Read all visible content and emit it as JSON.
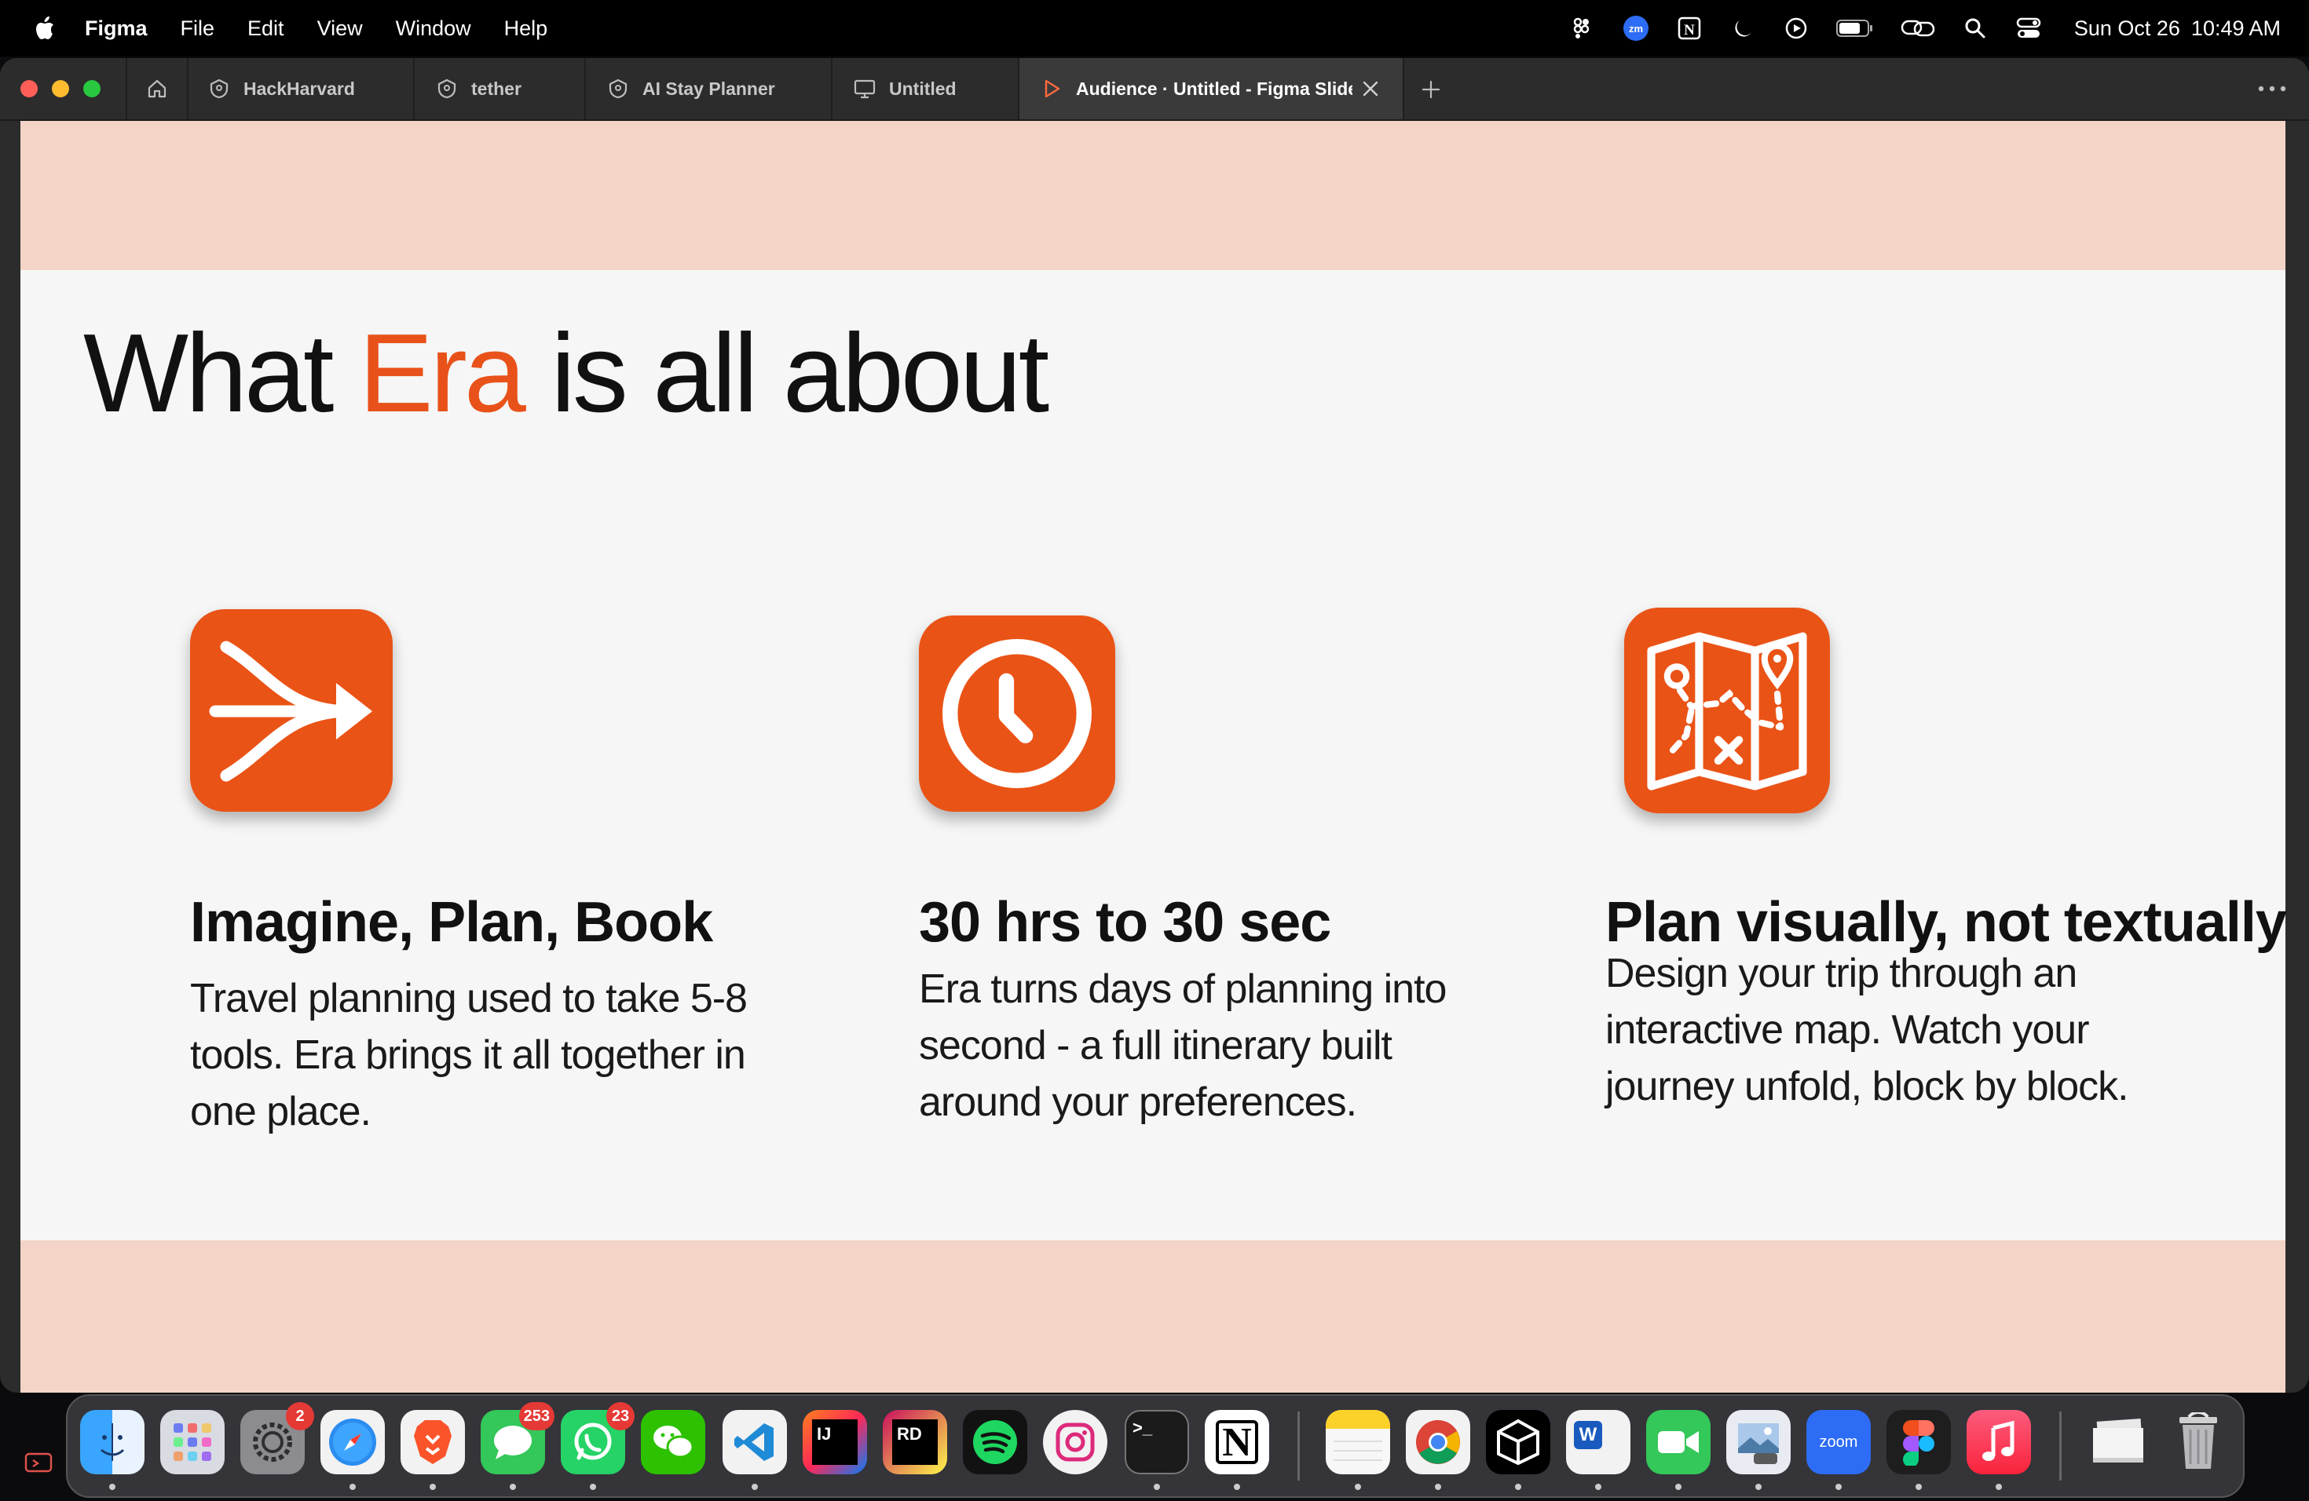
{
  "menubar": {
    "app_name": "Figma",
    "menus": [
      "File",
      "Edit",
      "View",
      "Window",
      "Help"
    ],
    "status_icons": [
      "figma-mirror-icon",
      "zoom-icon",
      "notion-icon",
      "moon-icon",
      "play-icon",
      "battery-icon",
      "link-icon",
      "search-icon",
      "control-center-icon"
    ],
    "date": "Sun Oct 26",
    "time": "10:49 AM"
  },
  "tabs": [
    {
      "label": "HackHarvard",
      "icon": "figma-file-icon"
    },
    {
      "label": "tether",
      "icon": "figma-file-icon"
    },
    {
      "label": "AI Stay Planner",
      "icon": "figma-file-icon"
    },
    {
      "label": "Untitled",
      "icon": "slides-icon"
    },
    {
      "label": "Audience · Untitled - Figma Slide",
      "icon": "play-icon",
      "active": true
    }
  ],
  "slide": {
    "title_before": "What ",
    "title_accent": "Era",
    "title_after": " is all about",
    "features": [
      {
        "icon": "merge-arrow-icon",
        "heading": "Imagine, Plan, Book",
        "lines": [
          "Travel planning used to take 5-8",
          "tools. Era brings it all together in",
          "one place."
        ]
      },
      {
        "icon": "clock-icon",
        "heading": "30 hrs to 30 sec",
        "lines": [
          "Era turns days of planning into",
          "second - a full itinerary built",
          "around your preferences."
        ]
      },
      {
        "icon": "map-icon",
        "heading": "Plan visually, not textually",
        "lines": [
          "Design your trip through an",
          "interactive map. Watch your",
          "journey unfold, block by block."
        ]
      }
    ]
  },
  "colors": {
    "accent": "#e8521a",
    "canvas_bg": "#f3d4c6",
    "slide_bg": "#f6f6f6"
  },
  "dock": {
    "items": [
      {
        "name": "finder"
      },
      {
        "name": "launchpad"
      },
      {
        "name": "system-settings",
        "badge": "2"
      },
      {
        "name": "safari"
      },
      {
        "name": "brave"
      },
      {
        "name": "messages",
        "badge": "253"
      },
      {
        "name": "whatsapp",
        "badge": "23"
      },
      {
        "name": "wechat"
      },
      {
        "name": "vscode"
      },
      {
        "name": "intellij",
        "text": "IJ"
      },
      {
        "name": "rider",
        "text": "RD"
      },
      {
        "name": "spotify"
      },
      {
        "name": "instagram"
      },
      {
        "name": "terminal",
        "text": ">_"
      },
      {
        "name": "notion",
        "text": "N"
      },
      {
        "name": "notes"
      },
      {
        "name": "chrome"
      },
      {
        "name": "unity"
      },
      {
        "name": "word",
        "text": "W"
      },
      {
        "name": "facetime"
      },
      {
        "name": "preview"
      },
      {
        "name": "zoom",
        "text": "zoom"
      },
      {
        "name": "figma"
      },
      {
        "name": "music"
      },
      {
        "name": "downloads"
      },
      {
        "name": "trash"
      }
    ]
  }
}
